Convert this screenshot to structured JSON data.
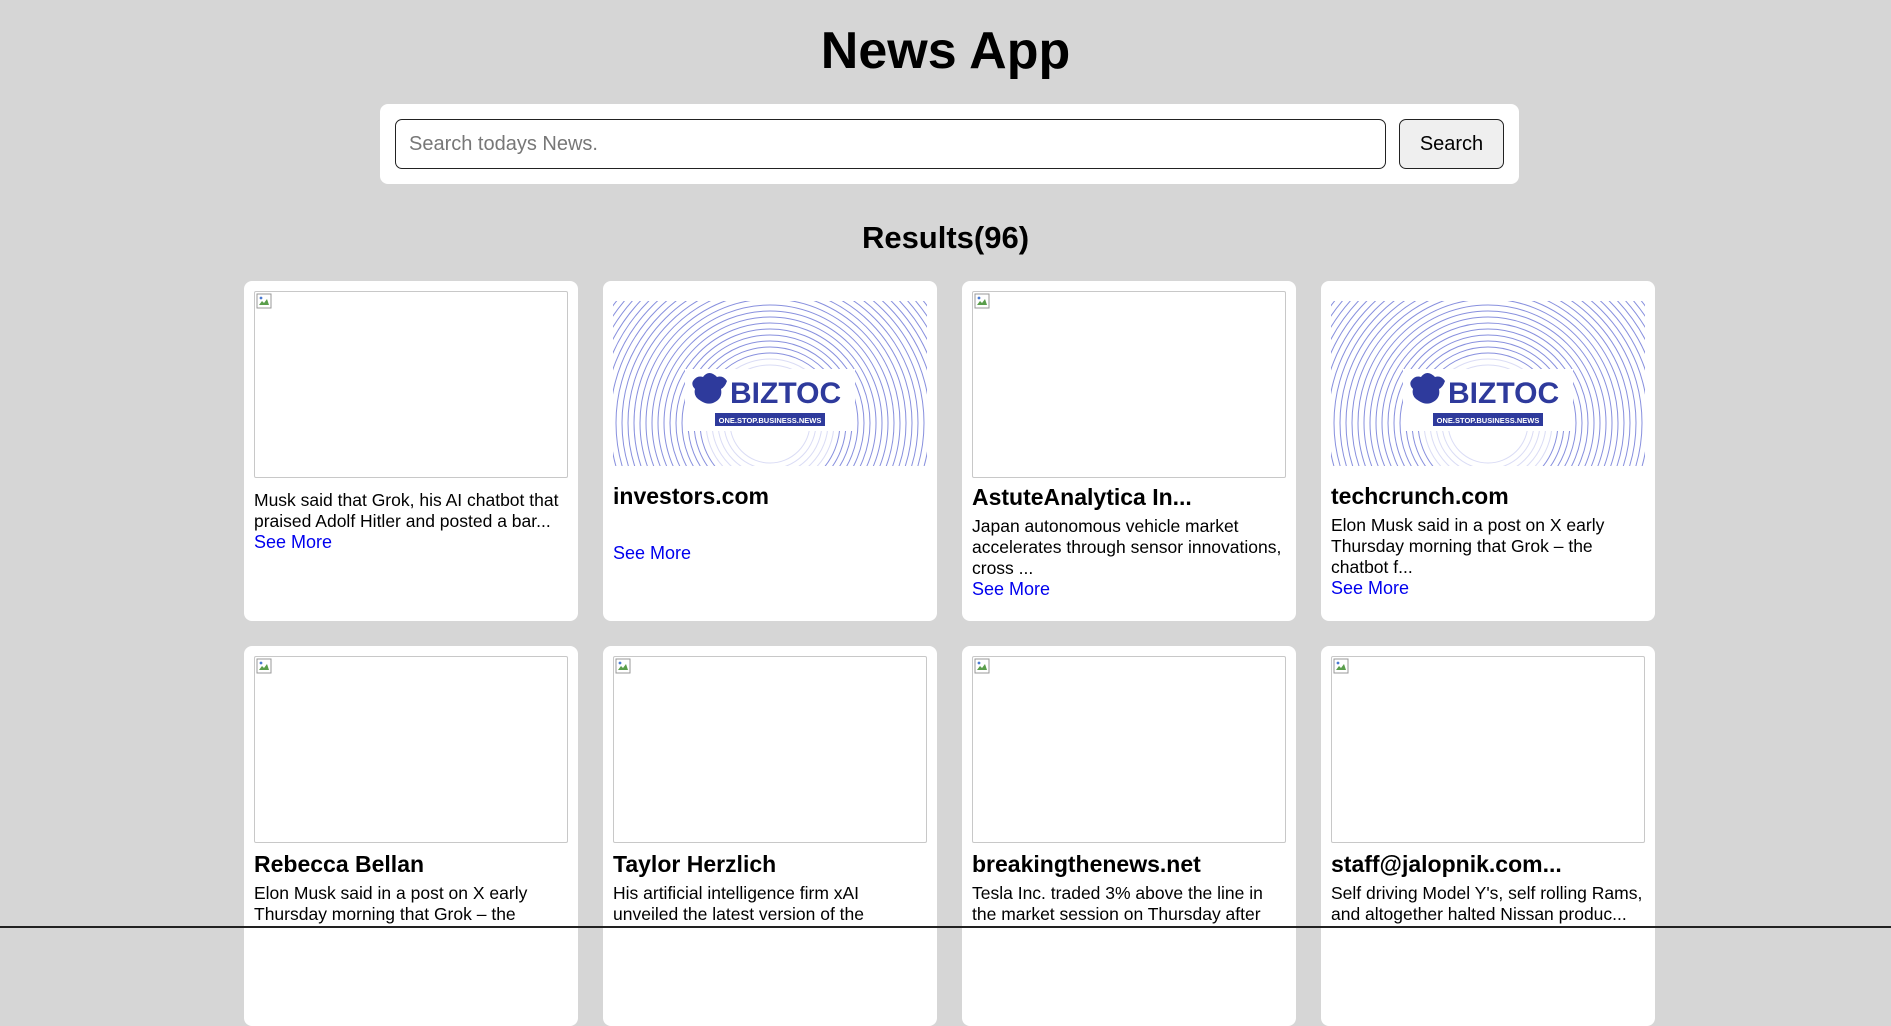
{
  "app": {
    "title": "News App"
  },
  "search": {
    "placeholder": "Search todays News.",
    "value": "",
    "button_label": "Search"
  },
  "results": {
    "heading": "Results(96)"
  },
  "cards": [
    {
      "image": "broken",
      "title": "",
      "description": "Musk said that Grok, his AI chatbot that praised Adolf Hitler and posted a bar...",
      "link": "See More"
    },
    {
      "image": "biztoc",
      "title": "investors.com",
      "description": "",
      "link": "See More"
    },
    {
      "image": "broken",
      "title": "AstuteAnalytica In...",
      "description": "Japan autonomous vehicle market accelerates through sensor innovations, cross ...",
      "link": "See More"
    },
    {
      "image": "biztoc",
      "title": "techcrunch.com",
      "description": "Elon Musk said in a post on X early Thursday morning that Grok – the chatbot f...",
      "link": "See More"
    },
    {
      "image": "broken",
      "title": "Rebecca Bellan",
      "description": "Elon Musk said in a post on X early Thursday morning that Grok – the",
      "link": ""
    },
    {
      "image": "broken",
      "title": "Taylor Herzlich",
      "description": "His artificial intelligence firm xAI unveiled the latest version of the",
      "link": ""
    },
    {
      "image": "broken",
      "title": "breakingthenews.net",
      "description": "Tesla Inc. traded 3% above the line in the market session on Thursday after",
      "link": ""
    },
    {
      "image": "broken",
      "title": "staff@jalopnik.com...",
      "description": "Self driving Model Y's, self rolling Rams, and altogether halted Nissan produc...",
      "link": ""
    }
  ],
  "biztoc_logo": {
    "brand": "BIZTOC",
    "tagline": "ONE.STOP.BUSINESS.NEWS",
    "color": "#2e3a9c"
  }
}
